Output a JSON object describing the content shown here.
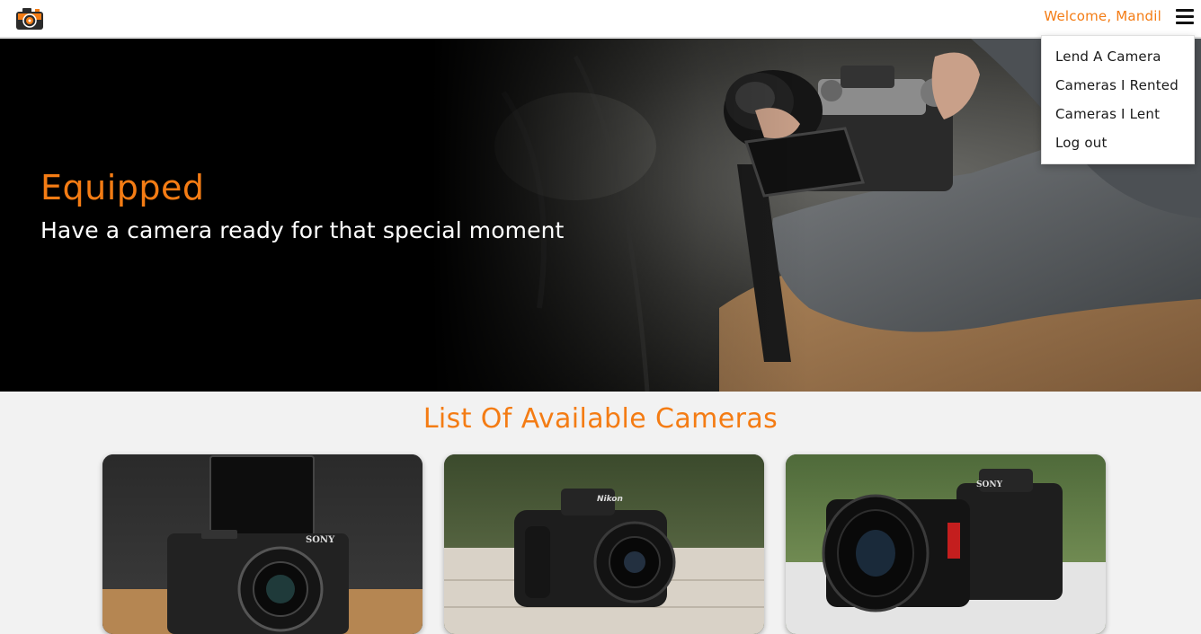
{
  "header": {
    "logo_icon": "camera-logo-icon",
    "welcome_text": "Welcome, Mandil",
    "menu_icon": "hamburger-menu-icon"
  },
  "menu": {
    "items": [
      {
        "label": "Lend A Camera"
      },
      {
        "label": "Cameras I Rented"
      },
      {
        "label": "Cameras I Lent"
      },
      {
        "label": "Log out"
      }
    ]
  },
  "hero": {
    "title": "Equipped",
    "subtitle": "Have a camera ready for that special moment"
  },
  "listing": {
    "heading": "List Of Available Cameras",
    "cards": [
      {
        "image_icon": "sony-compact-camera-photo",
        "brand_label": "SONY"
      },
      {
        "image_icon": "nikon-mirrorless-camera-photo",
        "brand_label": "Nikon"
      },
      {
        "image_icon": "sony-alpha-camera-photo",
        "brand_label": "SONY"
      }
    ]
  },
  "colors": {
    "accent": "#f47c14",
    "page_background": "#f2f2f2",
    "hero_background": "#000000"
  }
}
